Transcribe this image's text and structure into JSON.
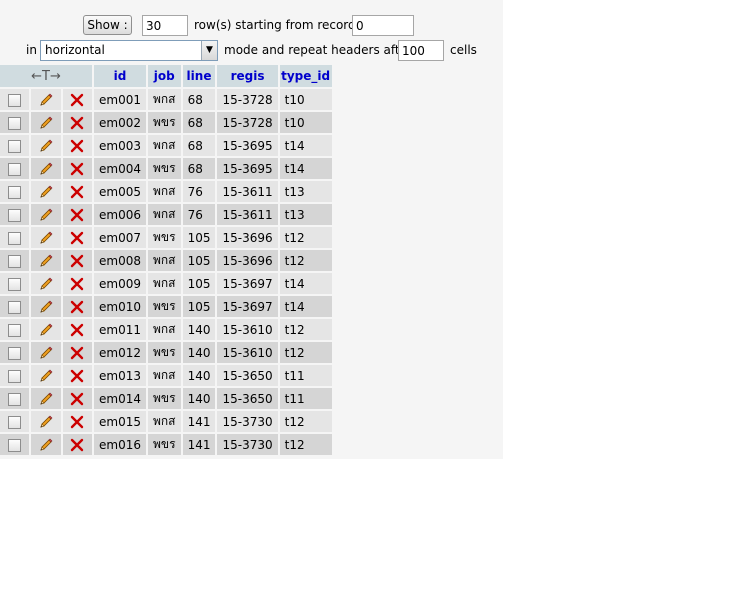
{
  "controls": {
    "show_label": "Show :",
    "rows_count": "30",
    "rows_label": "row(s) starting from record #",
    "start_record": "0",
    "in_label": "in",
    "mode_value": "horizontal",
    "mode_label": "mode and repeat headers after",
    "repeat_after": "100",
    "cells_label": "cells"
  },
  "table": {
    "sort_arrows": "←T→",
    "columns": [
      "id",
      "job",
      "line",
      "regis",
      "type_id"
    ],
    "rows": [
      [
        "em001",
        "พกส",
        "68",
        "15-3728",
        "t10"
      ],
      [
        "em002",
        "พขร",
        "68",
        "15-3728",
        "t10"
      ],
      [
        "em003",
        "พกส",
        "68",
        "15-3695",
        "t14"
      ],
      [
        "em004",
        "พขร",
        "68",
        "15-3695",
        "t14"
      ],
      [
        "em005",
        "พกส",
        "76",
        "15-3611",
        "t13"
      ],
      [
        "em006",
        "พกส",
        "76",
        "15-3611",
        "t13"
      ],
      [
        "em007",
        "พขร",
        "105",
        "15-3696",
        "t12"
      ],
      [
        "em008",
        "พกส",
        "105",
        "15-3696",
        "t12"
      ],
      [
        "em009",
        "พกส",
        "105",
        "15-3697",
        "t14"
      ],
      [
        "em010",
        "พขร",
        "105",
        "15-3697",
        "t14"
      ],
      [
        "em011",
        "พกส",
        "140",
        "15-3610",
        "t12"
      ],
      [
        "em012",
        "พขร",
        "140",
        "15-3610",
        "t12"
      ],
      [
        "em013",
        "พกส",
        "140",
        "15-3650",
        "t11"
      ],
      [
        "em014",
        "พขร",
        "140",
        "15-3650",
        "t11"
      ],
      [
        "em015",
        "พกส",
        "141",
        "15-3730",
        "t12"
      ],
      [
        "em016",
        "พขร",
        "141",
        "15-3730",
        "t12"
      ]
    ]
  },
  "icons": {
    "edit": "pencil-icon",
    "delete": "delete-x-icon",
    "select": "checkbox"
  },
  "colors": {
    "header_bg": "#d0dce0",
    "header_text": "#0000cc",
    "row_odd": "#e5e5e5",
    "row_even": "#d5d5d5",
    "delete_red": "#cc0000"
  }
}
